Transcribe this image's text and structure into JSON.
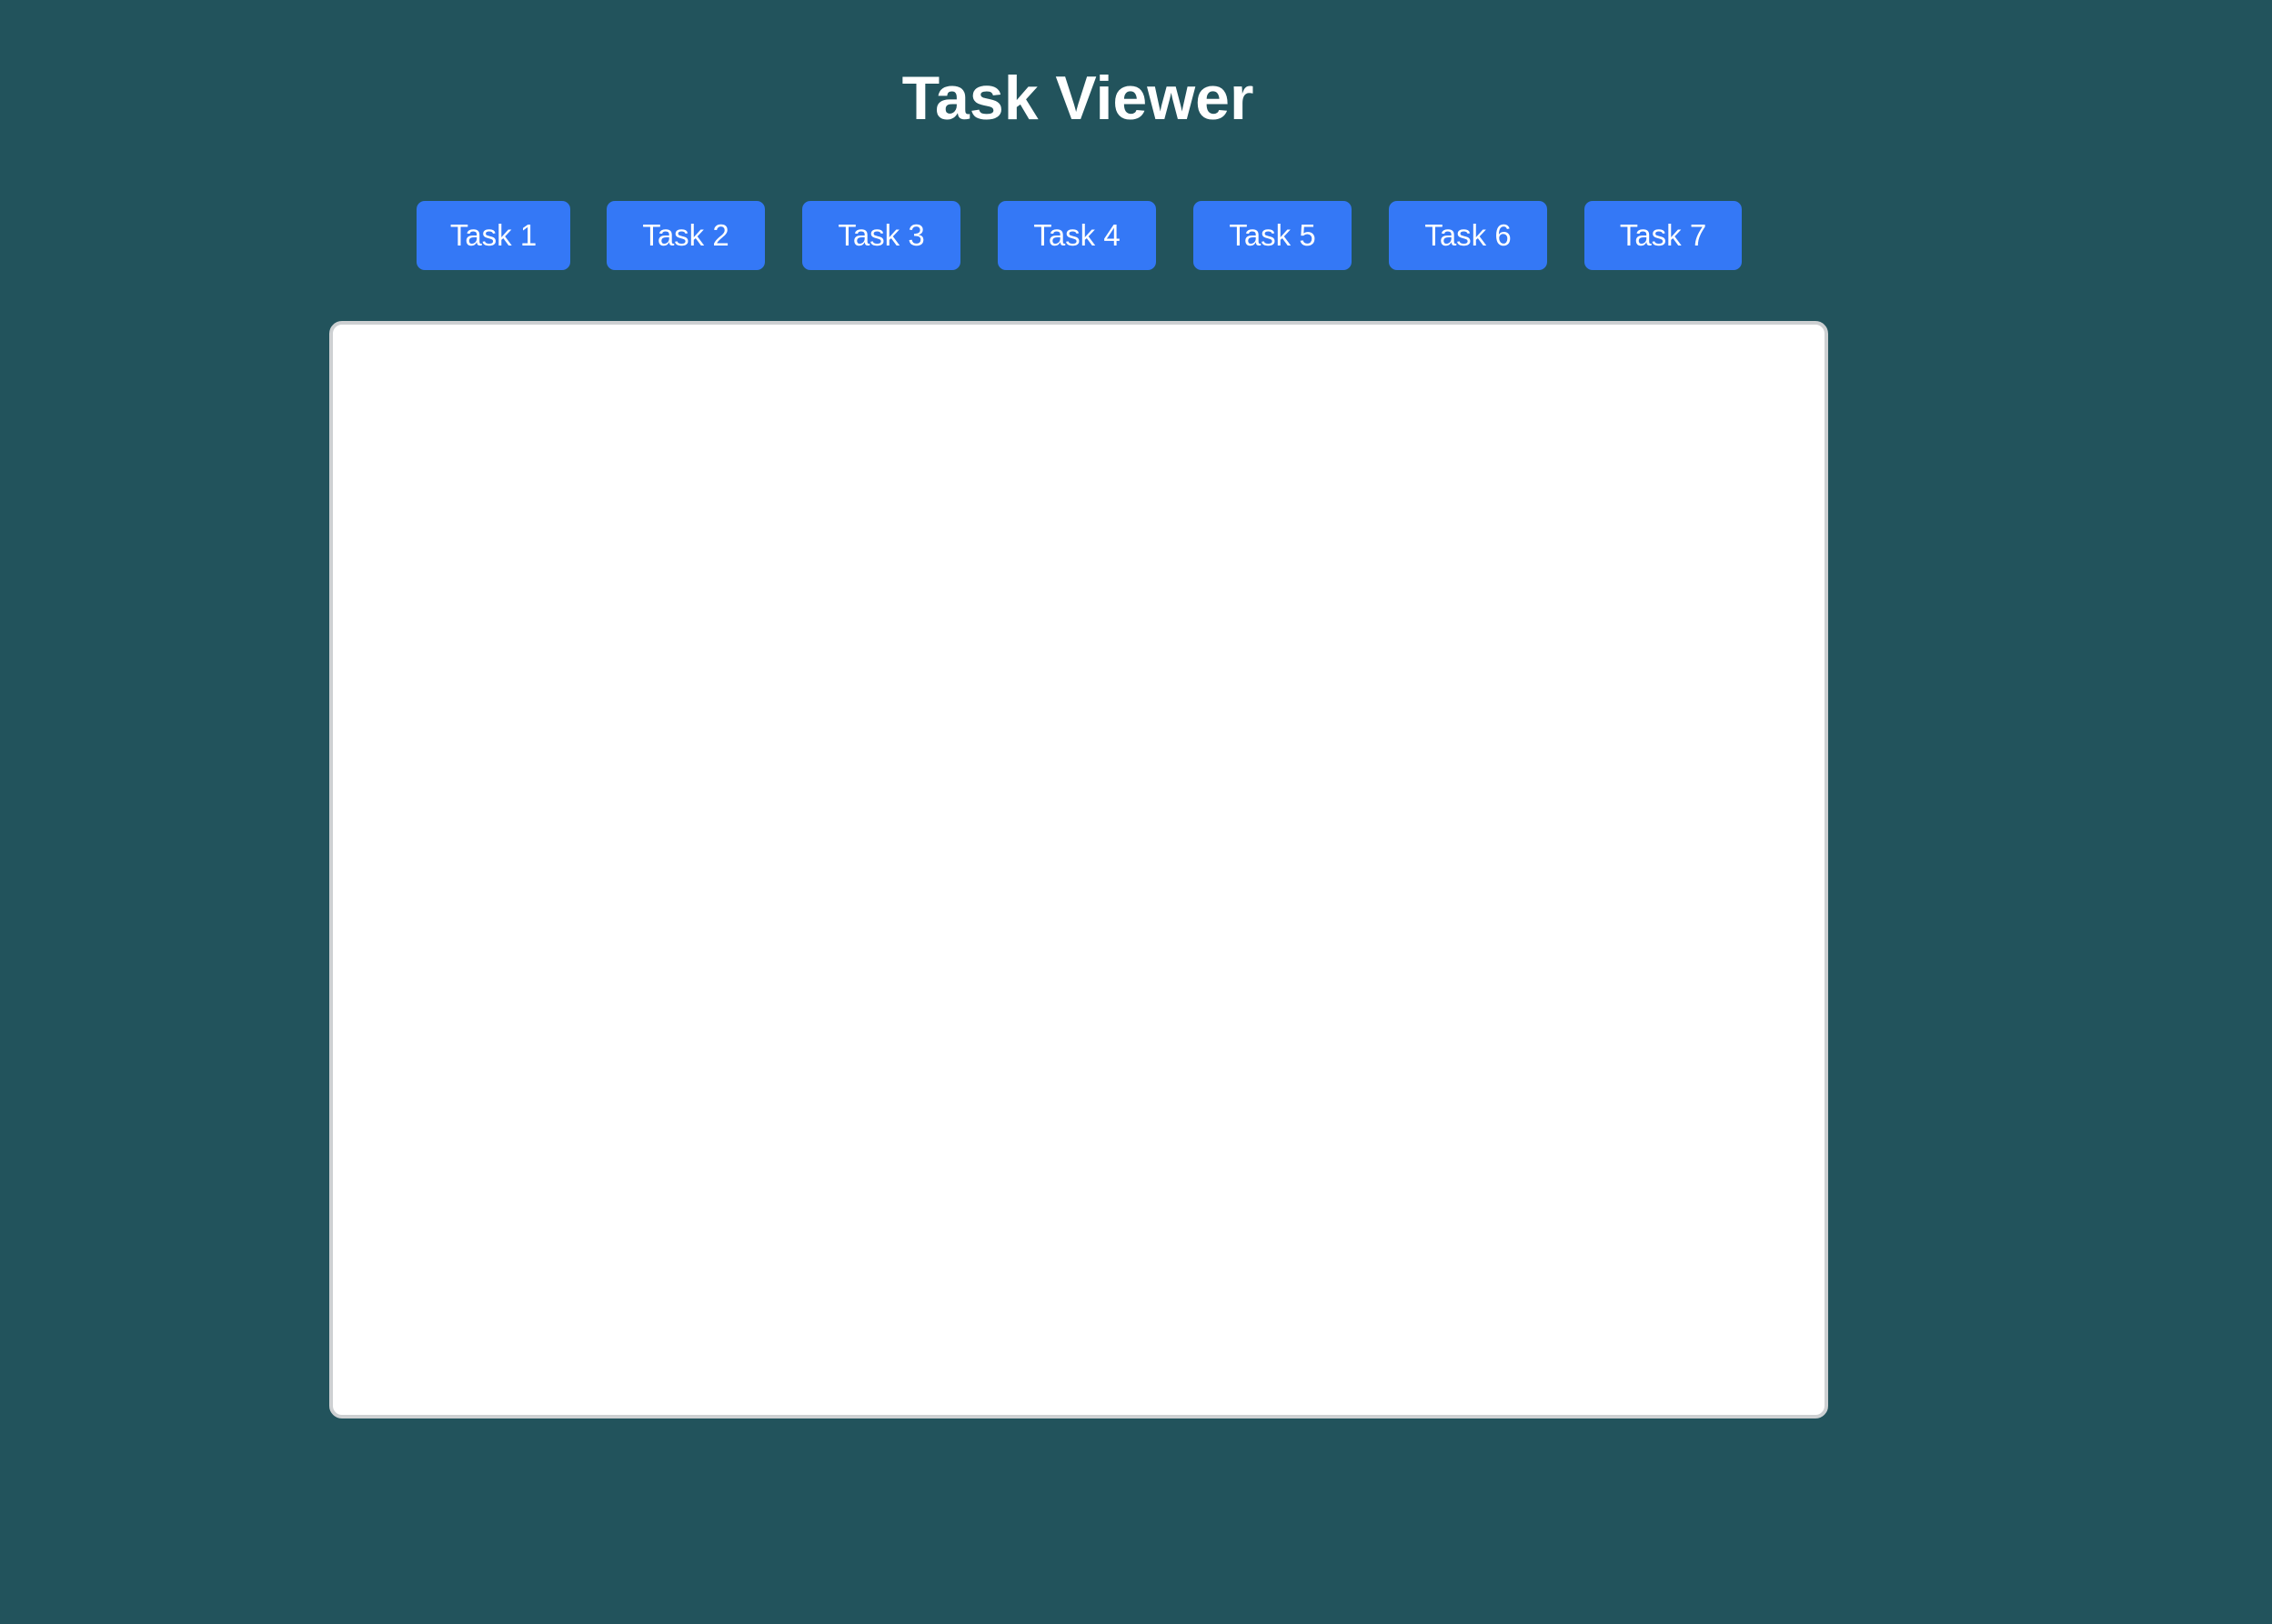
{
  "page": {
    "title": "Task Viewer",
    "background_color": "#22535c"
  },
  "task_bar": {
    "button_color": "#3478f6",
    "buttons": [
      {
        "label": "Task 1"
      },
      {
        "label": "Task 2"
      },
      {
        "label": "Task 3"
      },
      {
        "label": "Task 4"
      },
      {
        "label": "Task 5"
      },
      {
        "label": "Task 6"
      },
      {
        "label": "Task 7"
      }
    ]
  },
  "viewer": {
    "background_color": "#ffffff",
    "border_color": "#cdd0d2"
  }
}
